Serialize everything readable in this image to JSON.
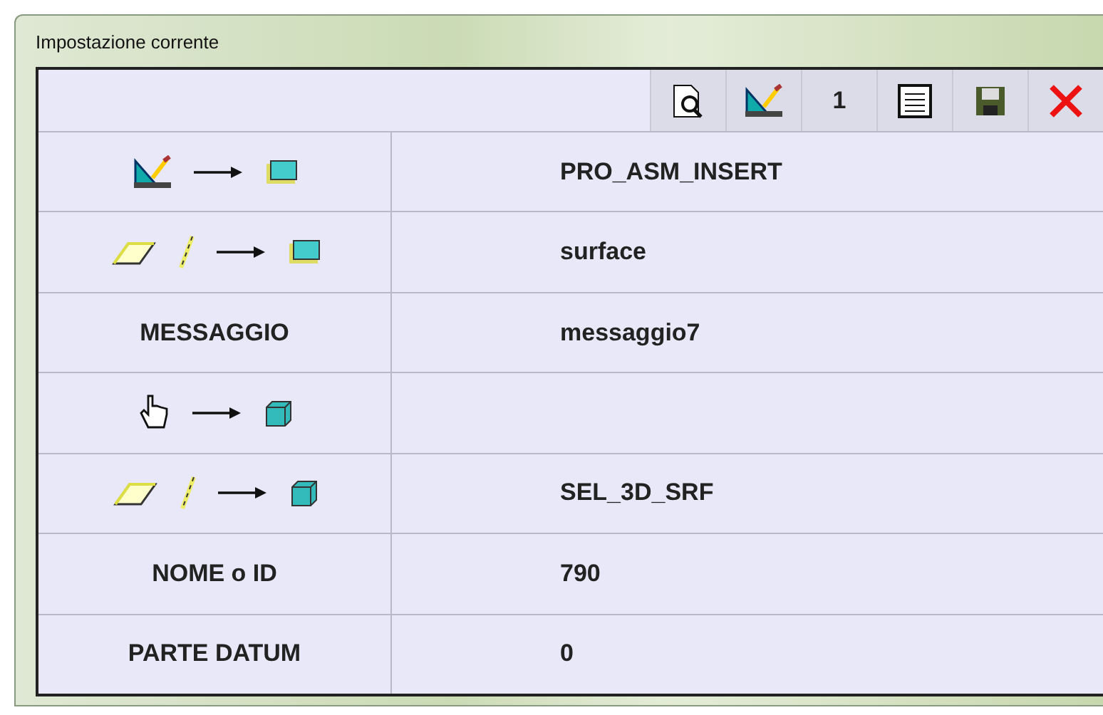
{
  "window": {
    "title": "Impostazione corrente"
  },
  "toolbar": [
    {
      "kind": "preview"
    },
    {
      "kind": "tool"
    },
    {
      "kind": "text",
      "label": "1"
    },
    {
      "kind": "form"
    },
    {
      "kind": "save"
    },
    {
      "kind": "close"
    }
  ],
  "rows": [
    {
      "kind": "tool",
      "value": "PRO_ASM_INSERT"
    },
    {
      "kind": "geometry",
      "value": "surface"
    },
    {
      "kind": "label",
      "label": "MESSAGGIO",
      "value": "messaggio7"
    },
    {
      "kind": "pick"
    },
    {
      "kind": "geometry3d",
      "value": "SEL_3D_SRF"
    },
    {
      "kind": "label",
      "label": "NOME o ID",
      "value": "790"
    },
    {
      "kind": "label",
      "label": "PARTE DATUM",
      "value": "0"
    }
  ]
}
